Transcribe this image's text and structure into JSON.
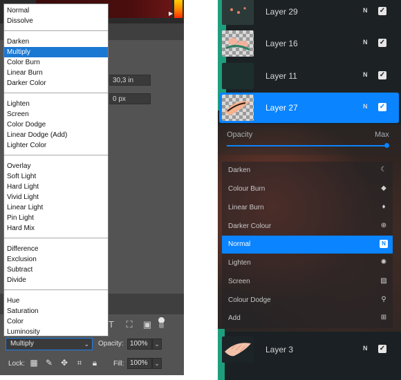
{
  "photoshop": {
    "blend_modes": [
      {
        "label": "Normal"
      },
      {
        "label": "Dissolve"
      },
      {
        "label": "Darken"
      },
      {
        "label": "Multiply",
        "selected": true
      },
      {
        "label": "Color Burn"
      },
      {
        "label": "Linear Burn"
      },
      {
        "label": "Darker Color"
      },
      {
        "label": "Lighten"
      },
      {
        "label": "Screen"
      },
      {
        "label": "Color Dodge"
      },
      {
        "label": "Linear Dodge (Add)"
      },
      {
        "label": "Lighter Color"
      },
      {
        "label": "Overlay"
      },
      {
        "label": "Soft Light"
      },
      {
        "label": "Hard Light"
      },
      {
        "label": "Vivid Light"
      },
      {
        "label": "Linear Light"
      },
      {
        "label": "Pin Light"
      },
      {
        "label": "Hard Mix"
      },
      {
        "label": "Difference"
      },
      {
        "label": "Exclusion"
      },
      {
        "label": "Subtract"
      },
      {
        "label": "Divide"
      },
      {
        "label": "Hue"
      },
      {
        "label": "Saturation"
      },
      {
        "label": "Color"
      },
      {
        "label": "Luminosity"
      }
    ],
    "width_field": "30,3 in",
    "offset_field": "0 px",
    "blend_select_value": "Multiply",
    "opacity_label": "Opacity:",
    "opacity_value": "100%",
    "fill_label": "Fill:",
    "fill_value": "100%",
    "lock_label": "Lock:",
    "accent_color": "#1a78d3"
  },
  "procreate": {
    "layers_top": [
      {
        "name": "Layer 29",
        "mode": "N"
      },
      {
        "name": "Layer 16",
        "mode": "N"
      },
      {
        "name": "Layer 11",
        "mode": "N"
      },
      {
        "name": "Layer 27",
        "mode": "N",
        "active": true
      }
    ],
    "opacity_label": "Opacity",
    "opacity_max_label": "Max",
    "opacity_level": 1.0,
    "modes": [
      {
        "label": "Darken",
        "icon": "moon-icon"
      },
      {
        "label": "Colour Burn",
        "icon": "burn-icon"
      },
      {
        "label": "Linear Burn",
        "icon": "flame-icon"
      },
      {
        "label": "Darker Colour",
        "icon": "plus-circle-icon"
      },
      {
        "label": "Normal",
        "icon": "n-badge-icon",
        "active": true,
        "badge": "N"
      },
      {
        "label": "Lighten",
        "icon": "sun-icon"
      },
      {
        "label": "Screen",
        "icon": "stripes-icon"
      },
      {
        "label": "Colour Dodge",
        "icon": "dodge-icon"
      },
      {
        "label": "Add",
        "icon": "plus-square-icon"
      }
    ],
    "layer_bottom": {
      "name": "Layer 3",
      "mode": "N"
    },
    "accent_color": "#0a84ff"
  }
}
